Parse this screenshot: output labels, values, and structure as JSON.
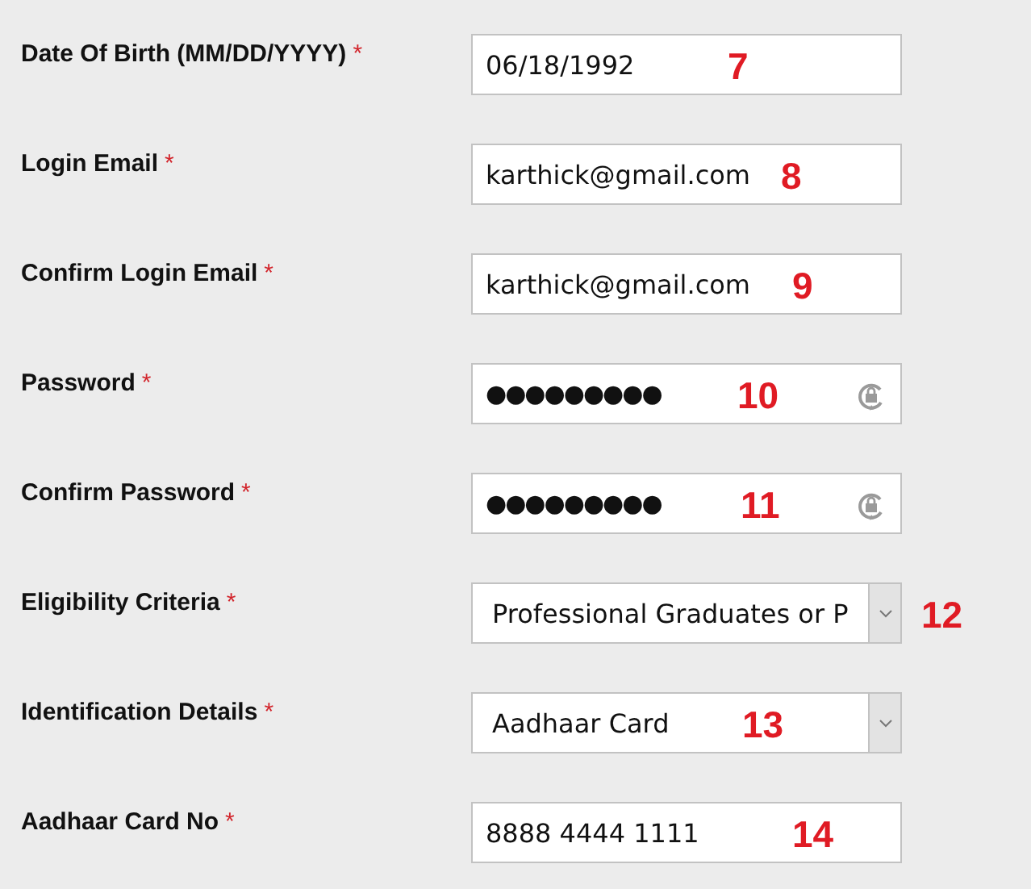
{
  "fields": [
    {
      "label": "Date Of Birth (MM/DD/YYYY)",
      "required": "*",
      "kind": "text",
      "value": "06/18/1992",
      "annotation": "7"
    },
    {
      "label": "Login Email",
      "required": "*",
      "kind": "text",
      "value": "karthick@gmail.com",
      "annotation": "8"
    },
    {
      "label": "Confirm Login Email",
      "required": "*",
      "kind": "text",
      "value": "karthick@gmail.com",
      "annotation": "9"
    },
    {
      "label": "Password",
      "required": "*",
      "kind": "password",
      "value": "●●●●●●●●●",
      "annotation": "10"
    },
    {
      "label": "Confirm Password",
      "required": "*",
      "kind": "password",
      "value": "●●●●●●●●●",
      "annotation": "11"
    },
    {
      "label": "Eligibility Criteria",
      "required": "*",
      "kind": "select",
      "value": "Professional Graduates or P",
      "annotation": "12"
    },
    {
      "label": "Identification Details",
      "required": "*",
      "kind": "select",
      "value": "Aadhaar Card",
      "annotation": "13"
    },
    {
      "label": "Aadhaar Card No",
      "required": "*",
      "kind": "text",
      "value": "8888 4444 1111",
      "annotation": "14"
    }
  ]
}
